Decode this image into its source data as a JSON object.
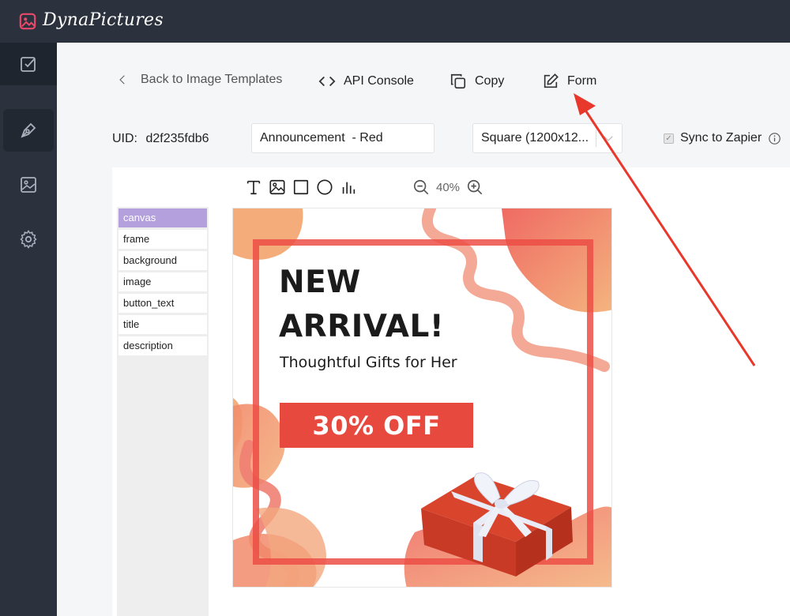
{
  "app": {
    "name": "DynaPictures"
  },
  "sidebar": {
    "items": [
      {
        "icon": "checklist-icon"
      },
      {
        "icon": "pen-nib-icon"
      },
      {
        "icon": "image-icon"
      },
      {
        "icon": "gear-icon"
      }
    ]
  },
  "toolbar": {
    "back_label": "Back to Image Templates",
    "api_label": "API Console",
    "copy_label": "Copy",
    "form_label": "Form"
  },
  "template": {
    "uid_label": "UID:",
    "uid_value": "d2f235fdb6",
    "name_value": "Announcement  - Red",
    "size_value": "Square (1200x12...",
    "sync_label": "Sync to Zapier",
    "sync_checked": true
  },
  "editor": {
    "zoom_label": "40%",
    "tools": [
      "text-tool-icon",
      "image-tool-icon",
      "rectangle-tool-icon",
      "circle-tool-icon",
      "chart-tool-icon"
    ],
    "layers": [
      "canvas",
      "frame",
      "background",
      "image",
      "button_text",
      "title",
      "description"
    ],
    "selected_layer": "canvas"
  },
  "canvas": {
    "headline_line1": "NEW",
    "headline_line2": "ARRIVAL!",
    "subtitle": "Thoughtful Gifts for Her",
    "offer": "30% OFF"
  },
  "colors": {
    "accent_red": "#e8493f",
    "annotation_arrow": "#e8382c",
    "selected_layer": "#b3a0dc",
    "topbar": "#2b323d"
  }
}
